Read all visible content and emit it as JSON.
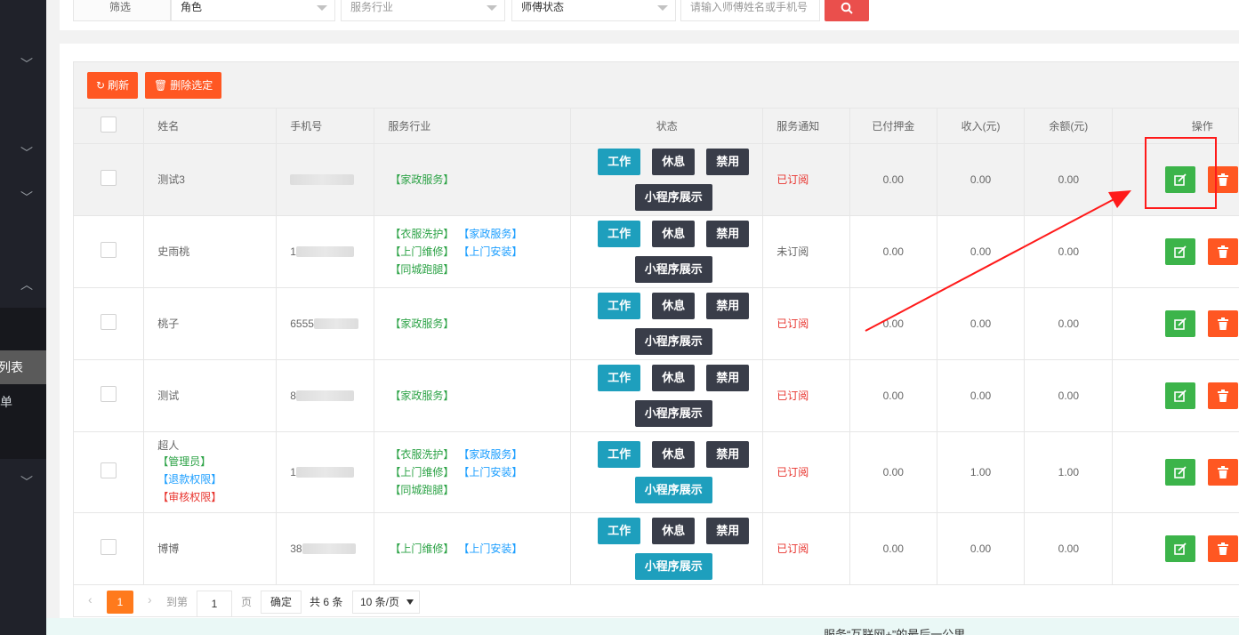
{
  "sidebar": {
    "active_item": "列表",
    "second_item": "单"
  },
  "filter": {
    "label": "筛选",
    "role_select": "角色",
    "industry_select": "服务行业",
    "status_select": "师傅状态",
    "search_placeholder": "请输入师傅姓名或手机号"
  },
  "toolbar": {
    "refresh_label": "刷新",
    "delete_selected_label": "删除选定"
  },
  "columns": [
    "姓名",
    "手机号",
    "服务行业",
    "状态",
    "服务通知",
    "已付押金",
    "收入(元)",
    "余额(元)",
    "操作"
  ],
  "status_buttons": {
    "work": "工作",
    "rest": "休息",
    "ban": "禁用",
    "mini": "小程序展示"
  },
  "rows": [
    {
      "name": "测试3",
      "role_tags": [],
      "phone": "",
      "industries": [
        {
          "t": "【家政服务】",
          "c": "green"
        }
      ],
      "notice": "已订阅",
      "notice_color": "red",
      "deposit": "0.00",
      "income": "0.00",
      "balance": "0.00"
    },
    {
      "name": "史雨桃",
      "role_tags": [],
      "phone": "1",
      "industries": [
        {
          "t": "【衣服洗护】",
          "c": "green"
        },
        {
          "t": "【家政服务】",
          "c": "blue"
        },
        {
          "t": "【上门维修】",
          "c": "green"
        },
        {
          "t": "【上门安装】",
          "c": "blue"
        },
        {
          "t": "【同城跑腿】",
          "c": "green"
        }
      ],
      "notice": "未订阅",
      "notice_color": "gray",
      "deposit": "0.00",
      "income": "0.00",
      "balance": "0.00"
    },
    {
      "name": "桃子",
      "role_tags": [],
      "phone": "6555",
      "industries": [
        {
          "t": "【家政服务】",
          "c": "green"
        }
      ],
      "notice": "已订阅",
      "notice_color": "red",
      "deposit": "0.00",
      "income": "0.00",
      "balance": "0.00"
    },
    {
      "name": "测试",
      "role_tags": [],
      "phone": "8",
      "industries": [
        {
          "t": "【家政服务】",
          "c": "green"
        }
      ],
      "notice": "已订阅",
      "notice_color": "red",
      "deposit": "0.00",
      "income": "0.00",
      "balance": "0.00"
    },
    {
      "name": "超人",
      "role_tags": [
        {
          "t": "【管理员】",
          "c": "green"
        },
        {
          "t": "【退款权限】",
          "c": "blue"
        },
        {
          "t": "【审核权限】",
          "c": "red"
        }
      ],
      "phone": "1",
      "industries": [
        {
          "t": "【衣服洗护】",
          "c": "green"
        },
        {
          "t": "【家政服务】",
          "c": "blue"
        },
        {
          "t": "【上门维修】",
          "c": "green"
        },
        {
          "t": "【上门安装】",
          "c": "blue"
        },
        {
          "t": "【同城跑腿】",
          "c": "green"
        }
      ],
      "notice": "已订阅",
      "notice_color": "red",
      "deposit": "0.00",
      "income": "1.00",
      "balance": "1.00"
    },
    {
      "name": "博博",
      "role_tags": [],
      "phone": "38",
      "industries": [
        {
          "t": "【上门维修】",
          "c": "green"
        },
        {
          "t": "【上门安装】",
          "c": "blue"
        }
      ],
      "notice": "已订阅",
      "notice_color": "red",
      "deposit": "0.00",
      "income": "0.00",
      "balance": "0.00"
    }
  ],
  "pager": {
    "current": "1",
    "goto_label": "到第",
    "input_value": "1",
    "page_label": "页",
    "confirm_label": "确定",
    "total_label": "共 6 条",
    "page_size": "10 条/页"
  },
  "footer_text": "服务“互联网+”的最后一公里",
  "colors": {
    "accent_orange": "#ff5722",
    "green": "#3cb44a",
    "teal": "#1e9fbd",
    "dark": "#393d49"
  }
}
